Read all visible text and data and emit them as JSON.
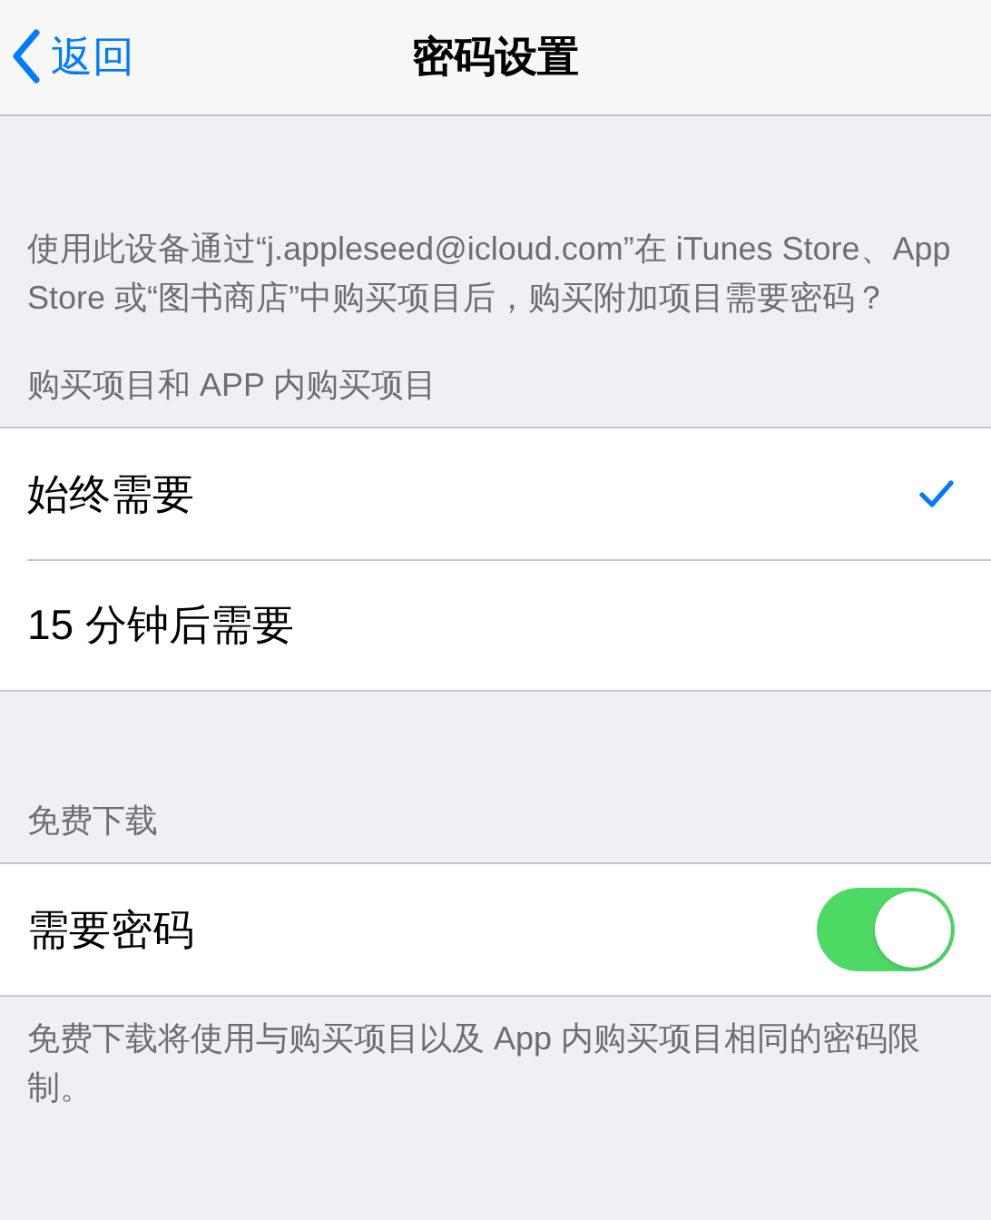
{
  "nav": {
    "back": "返回",
    "title": "密码设置"
  },
  "description": "使用此设备通过“j.appleseed@icloud.com”在 iTunes Store、App Store 或“图书商店”中购买项目后，购买附加项目需要密码？",
  "sections": [
    {
      "header": "购买项目和 APP 内购买项目",
      "rows": [
        {
          "kind": "choice",
          "label": "始终需要",
          "selected": true
        },
        {
          "kind": "choice",
          "label": "15 分钟后需要",
          "selected": false
        }
      ]
    },
    {
      "header": "免费下载",
      "rows": [
        {
          "kind": "toggle",
          "label": "需要密码",
          "on": true
        }
      ],
      "footer": "免费下载将使用与购买项目以及 App 内购买项目相同的密码限制。"
    }
  ]
}
